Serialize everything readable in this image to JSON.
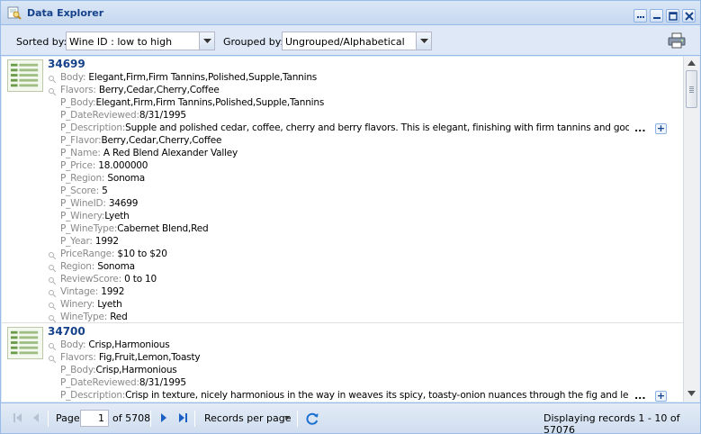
{
  "window": {
    "title": "Data Explorer"
  },
  "toolbar": {
    "sorted_by_label": "Sorted by:",
    "sort_value": "Wine ID : low to high",
    "grouped_by_label": "Grouped by:",
    "group_value": "Ungrouped/Alphabetical"
  },
  "records": [
    {
      "id": "34699",
      "props": [
        {
          "key": "Body:",
          "value": "Elegant,Firm,Firm Tannins,Polished,Supple,Tannins"
        },
        {
          "key": "Flavors:",
          "value": "Berry,Cedar,Cherry,Coffee"
        }
      ],
      "p_props": [
        {
          "key": "P_Body:",
          "value": "Elegant,Firm,Firm Tannins,Polished,Supple,Tannins"
        },
        {
          "key": "P_DateReviewed:",
          "value": "8/31/1995"
        },
        {
          "key": "P_Description:",
          "value": "Supple and polished cedar, coffee, cherry and berry flavors. This is elegant, finishing with firm tannins and good"
        },
        {
          "key": "P_Flavor:",
          "value": "Berry,Cedar,Cherry,Coffee"
        },
        {
          "key": "P_Name:",
          "value": "A Red Blend Alexander Valley"
        },
        {
          "key": "P_Price:",
          "value": "18.000000"
        },
        {
          "key": "P_Region:",
          "value": "Sonoma"
        },
        {
          "key": "P_Score:",
          "value": "5"
        },
        {
          "key": "P_WineID:",
          "value": "34699"
        },
        {
          "key": "P_Winery:",
          "value": "Lyeth"
        },
        {
          "key": "P_WineType:",
          "value": "Cabernet Blend,Red"
        },
        {
          "key": "P_Year:",
          "value": "1992"
        }
      ],
      "tail_props": [
        {
          "key": "PriceRange:",
          "value": "$10 to $20"
        },
        {
          "key": "Region:",
          "value": "Sonoma"
        },
        {
          "key": "ReviewScore:",
          "value": "0 to 10"
        },
        {
          "key": "Vintage:",
          "value": "1992"
        },
        {
          "key": "Winery:",
          "value": "Lyeth"
        },
        {
          "key": "WineType:",
          "value": "Red"
        }
      ],
      "ellipsis": "...",
      "expand": "+"
    },
    {
      "id": "34700",
      "props": [
        {
          "key": "Body:",
          "value": "Crisp,Harmonious"
        },
        {
          "key": "Flavors:",
          "value": "Fig,Fruit,Lemon,Toasty"
        }
      ],
      "p_props": [
        {
          "key": "P_Body:",
          "value": "Crisp,Harmonious"
        },
        {
          "key": "P_DateReviewed:",
          "value": "8/31/1995"
        },
        {
          "key": "P_Description:",
          "value": "Crisp in texture, nicely harmonious in the way in weaves its spicy, toasty-onion nuances through the fig and lemon"
        }
      ],
      "ellipsis": "...",
      "expand": "+"
    }
  ],
  "paging": {
    "page_label": "Page",
    "current_page": "1",
    "of_pages": "of 5708",
    "records_per_page": "Records per page",
    "display_msg": "Displaying records 1 - 10 of 57076"
  },
  "colors": {
    "accent": "#15428b",
    "border": "#99bbe8",
    "toolbar_bg": "#dfe8f6"
  },
  "icons": {
    "title": "data-explorer-icon",
    "print": "print-icon",
    "first": "first-page-icon",
    "prev": "prev-page-icon",
    "next": "next-page-icon",
    "last": "last-page-icon",
    "refresh": "refresh-icon"
  }
}
